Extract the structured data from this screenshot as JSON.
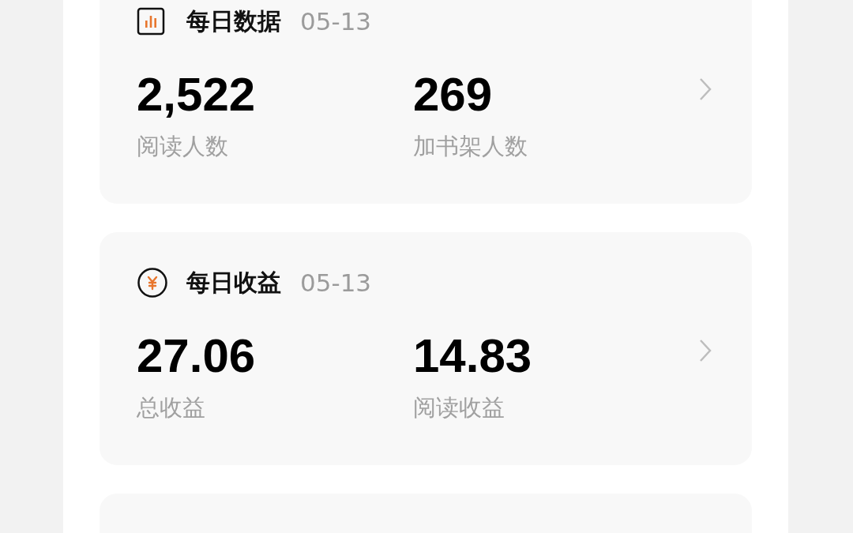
{
  "cards": [
    {
      "kind": "chart",
      "title": "每日数据",
      "date": "05-13",
      "stats": [
        {
          "value": "2,522",
          "label": "阅读人数"
        },
        {
          "value": "269",
          "label": "加书架人数"
        }
      ]
    },
    {
      "kind": "money",
      "title": "每日收益",
      "date": "05-13",
      "stats": [
        {
          "value": "27.06",
          "label": "总收益"
        },
        {
          "value": "14.83",
          "label": "阅读收益"
        }
      ]
    }
  ]
}
